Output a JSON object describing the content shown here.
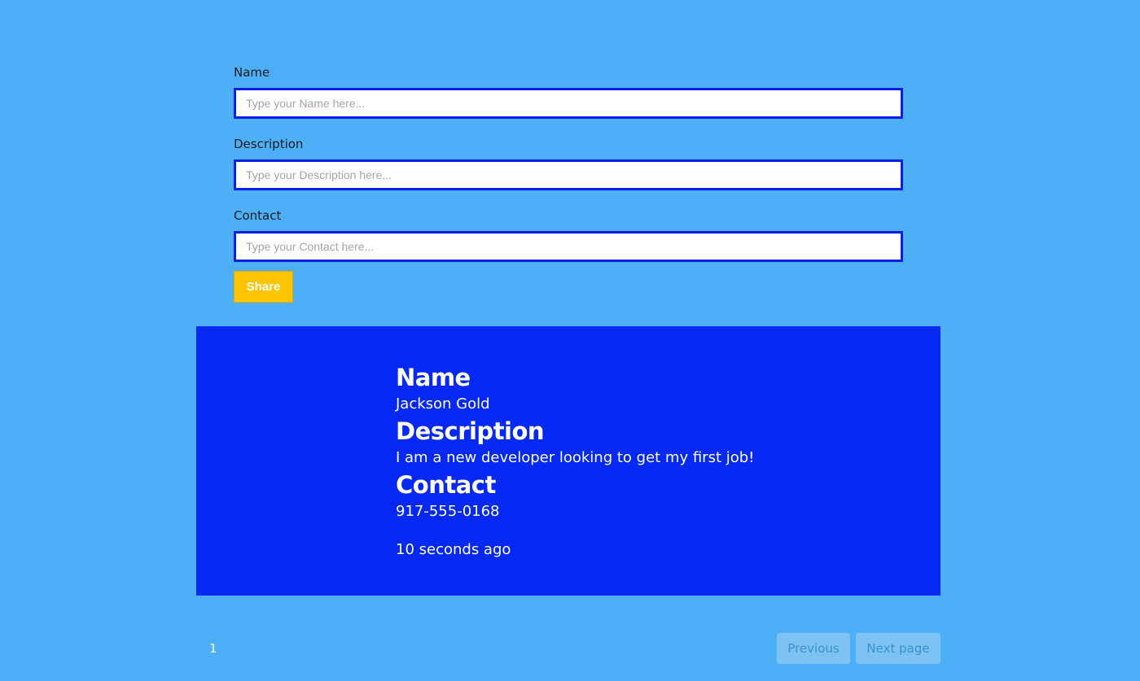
{
  "form": {
    "fields": [
      {
        "label": "Name",
        "placeholder": "Type your Name here...",
        "value": ""
      },
      {
        "label": "Description",
        "placeholder": "Type your Description here...",
        "value": ""
      },
      {
        "label": "Contact",
        "placeholder": "Type your Contact here...",
        "value": ""
      }
    ],
    "submit_label": "Share"
  },
  "post": {
    "name_heading": "Name",
    "name_value": "Jackson Gold",
    "description_heading": "Description",
    "description_value": "I am a new developer looking to get my first job!",
    "contact_heading": "Contact",
    "contact_value": "917-555-0168",
    "timestamp": "10 seconds ago"
  },
  "pagination": {
    "current_page": "1",
    "previous_label": "Previous",
    "next_label": "Next page",
    "previous_disabled": true,
    "next_disabled": true
  },
  "colors": {
    "background": "#4db0f7",
    "card": "#0529f3",
    "input_border": "#0a1ee6",
    "share_button": "#ffc400",
    "pager_button": "#7cc2f3"
  }
}
